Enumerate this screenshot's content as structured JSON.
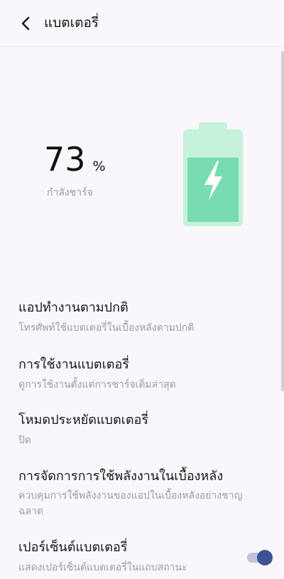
{
  "header": {
    "title": "แบตเตอรี่",
    "back_icon": "chevron-left-icon"
  },
  "battery": {
    "level_percent": 73,
    "value": "73",
    "unit": "%",
    "status": "กำลังชาร์จ",
    "icon": "charging-bolt-icon",
    "colors": {
      "body": "#c6f2dc",
      "fill": "#79dcb0",
      "bolt": "#ffffff"
    }
  },
  "settings": [
    {
      "title": "แอปทำงานตามปกติ",
      "subtitle": "โทรศัพท์ใช้แบตเตอรี่ในเบื้องหลังตามปกติ"
    },
    {
      "title": "การใช้งานแบตเตอรี่",
      "subtitle": "ดูการใช้งานตั้งแต่การชาร์จเต็มล่าสุด"
    },
    {
      "title": "โหมดประหยัดแบตเตอรี่",
      "subtitle": "ปิด"
    },
    {
      "title": "การจัดการการใช้พลังงานในเบื้องหลัง",
      "subtitle": "ควบคุมการใช้พลังงานของแอปในเบื้องหลังอย่างชาญฉลาด"
    },
    {
      "title": "เปอร์เซ็นต์แบตเตอรี่",
      "subtitle": "แสดงเปอร์เซ็นต์แบตเตอรี่ในแถบสถานะ",
      "toggle_on": true
    }
  ],
  "theme": {
    "accent": "#3d5396",
    "toggle_track": "#bfc4da",
    "background": "#f9f7fb"
  }
}
